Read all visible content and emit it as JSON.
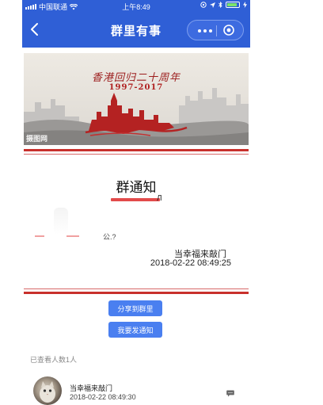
{
  "status_bar": {
    "carrier": "中国联通",
    "time": "上午8:49"
  },
  "nav": {
    "title": "群里有事"
  },
  "banner": {
    "title": "香港回归二十周年",
    "years": "1997-2017",
    "watermark": "摄图网"
  },
  "notice": {
    "heading": "群通知",
    "title_fragment": "Л",
    "blur_text": "公.?",
    "sender": "当幸福来敲门",
    "time": "2018-02-22 08:49:25"
  },
  "actions": {
    "share_label": "分享到群里",
    "publish_label": "我要发通知"
  },
  "viewers": {
    "count_label": "已查看人数1人",
    "items": [
      {
        "name": "当幸福来敲门",
        "time": "2018-02-22 08:49:30"
      }
    ]
  },
  "colors": {
    "primary": "#2f5fd6",
    "button": "#4a7ff0",
    "stripe_red": "#c8302c"
  }
}
